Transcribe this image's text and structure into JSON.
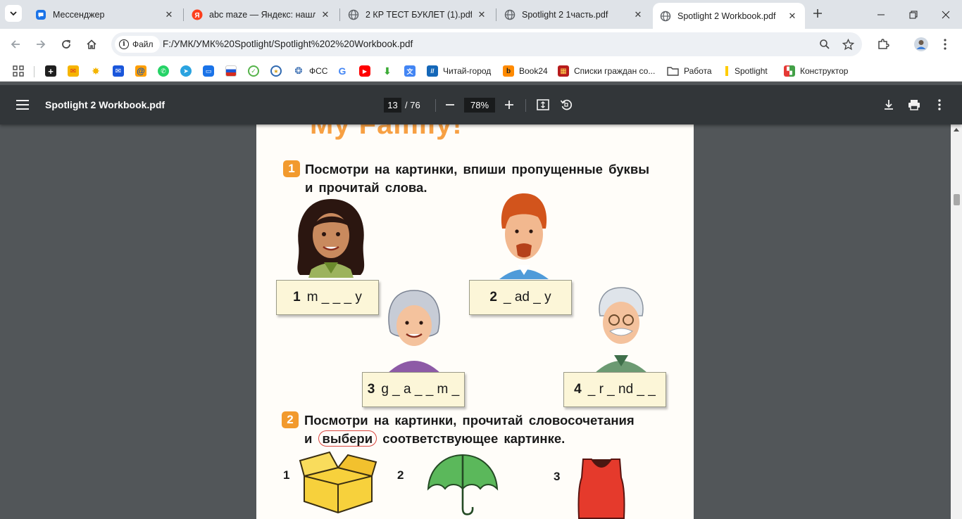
{
  "tabs": [
    {
      "title": "Мессенджер",
      "close": "✕"
    },
    {
      "title": "abc maze — Яндекс: нашлось",
      "close": "✕"
    },
    {
      "title": "2 КР ТЕСТ БУКЛЕТ (1).pdf",
      "close": "✕"
    },
    {
      "title": "Spotlight 2 1часть.pdf",
      "close": "✕"
    },
    {
      "title": "Spotlight 2 Workbook.pdf",
      "close": "✕"
    }
  ],
  "address": {
    "chip_label": "Файл",
    "url": "F:/УМК/УМК%20Spotlight/Spotlight%202%20Workbook.pdf"
  },
  "bookmarks": {
    "fss": "ФСС",
    "chitai": "Читай-город",
    "book24": "Book24",
    "spiski": "Списки граждан со...",
    "rabota": "Работа",
    "spotlight": "Spotlight",
    "konstruktor": "Конструктор"
  },
  "pdf": {
    "title": "Spotlight 2 Workbook.pdf",
    "page_current": "13",
    "page_total": "/ 76",
    "zoom": "78%"
  },
  "page_content": {
    "heading": "My Family!",
    "ex1_number": "1",
    "ex1_line1": "Посмотри на картинки, впиши пропущенные буквы",
    "ex1_line2": "и прочитай слова.",
    "words": [
      {
        "num": "1",
        "text": "m _ _ _ y"
      },
      {
        "num": "2",
        "text": "_ ad _ y"
      },
      {
        "num": "3",
        "text": "g _ a _ _ m _"
      },
      {
        "num": "4",
        "text": "_ r _ nd _ _"
      }
    ],
    "ex2_number": "2",
    "ex2_line1": "Посмотри на картинки, прочитай словосочетания",
    "ex2_line2_start": "и",
    "ex2_circled": "выбери",
    "ex2_line2_end": "соответствующее картинке.",
    "pic_numbers": [
      "1",
      "2",
      "3"
    ]
  }
}
